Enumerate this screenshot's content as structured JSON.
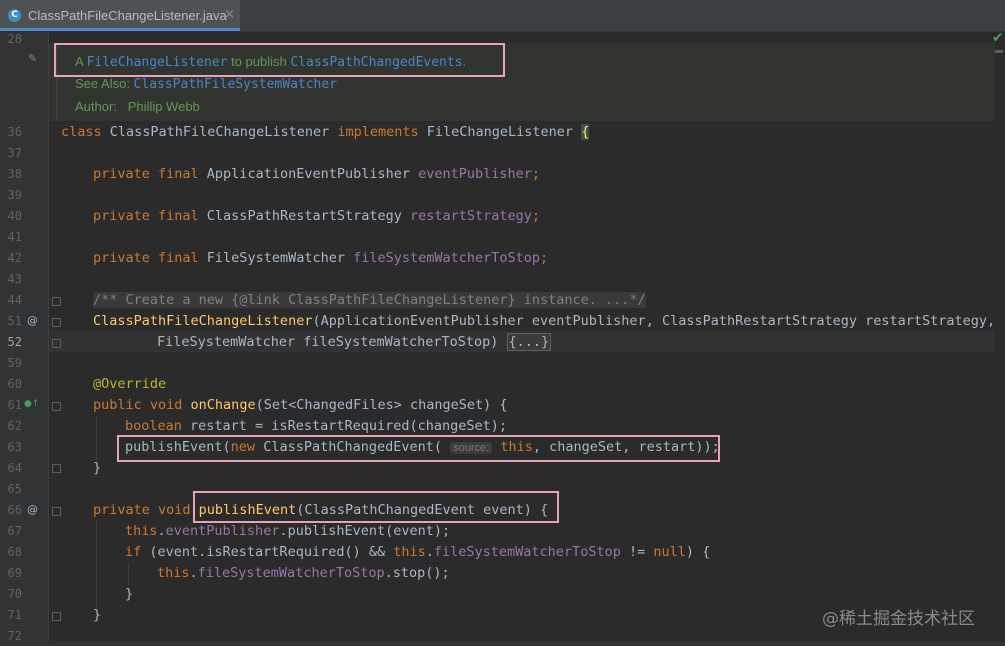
{
  "tab": {
    "title": "ClassPathFileChangeListener.java",
    "close": "×",
    "icon_letter": "C"
  },
  "editor": {
    "line_numbers": [
      "28",
      "36",
      "37",
      "38",
      "39",
      "40",
      "41",
      "42",
      "43",
      "44",
      "51",
      "52",
      "59",
      "60",
      "61",
      "62",
      "63",
      "64",
      "65",
      "66",
      "67",
      "68",
      "69",
      "70",
      "71",
      "72"
    ],
    "current_line": "52",
    "javadoc": {
      "summary_prefix": "A ",
      "summary_link1": "FileChangeListener",
      "summary_middle": " to publish ",
      "summary_link2": "ClassPathChangedEvents",
      "summary_suffix": ".",
      "see_also_label": "See Also: ",
      "see_also_link": "ClassPathFileSystemWatcher",
      "author_label": "Author:",
      "author_name": "Phillip Webb"
    },
    "lines": {
      "l36": {
        "kw1": "class",
        "name": " ClassPathFileChangeListener ",
        "kw2": "implements",
        "iface": " FileChangeListener ",
        "brace": "{"
      },
      "l38": {
        "kw": "private final",
        "type": " ApplicationEventPublisher ",
        "field": "eventPublisher",
        "semi": ";"
      },
      "l40": {
        "kw": "private final",
        "type": " ClassPathRestartStrategy ",
        "field": "restartStrategy",
        "semi": ";"
      },
      "l42": {
        "kw": "private final",
        "type": " FileSystemWatcher ",
        "field": "fileSystemWatcherToStop",
        "semi": ";"
      },
      "l44": {
        "comment": "/** Create a new {@link ClassPathFileChangeListener} instance. ...*/"
      },
      "l51": {
        "method": "ClassPathFileChangeListener",
        "params": "(ApplicationEventPublisher eventPublisher, ClassPathRestartStrategy restartStrategy,"
      },
      "l52": {
        "params": "FileSystemWatcher fileSystemWatcherToStop) ",
        "folded": "{...}"
      },
      "l60": {
        "annotation": "@Override"
      },
      "l61": {
        "kw": "public void ",
        "method": "onChange",
        "params": "(Set<ChangedFiles> changeSet) {"
      },
      "l62": {
        "kw": "boolean",
        "rest": " restart = isRestartRequired(changeSet);"
      },
      "l63": {
        "call": "publishEvent(",
        "kw_new": "new",
        "type": " ClassPathChangedEvent(",
        "hint": "source:",
        "kw_this": " this",
        "rest": ", changeSet, restart));"
      },
      "l64": {
        "text": "}"
      },
      "l66": {
        "kw": "private void ",
        "method": "publishEvent",
        "params": "(ClassPathChangedEvent event) {"
      },
      "l67": {
        "kw_this": "this",
        "dot": ".",
        "field": "eventPublisher",
        "rest": ".publishEvent(event);"
      },
      "l68": {
        "kw_if": "if",
        "part1": " (event.isRestartRequired() && ",
        "kw_this": "this",
        "dot": ".",
        "field": "fileSystemWatcherToStop",
        "part2": " != ",
        "kw_null": "null",
        "part3": ") {"
      },
      "l69": {
        "kw_this": "this",
        "dot": ".",
        "field": "fileSystemWatcherToStop",
        "rest": ".stop();"
      },
      "l70": {
        "text": "}"
      },
      "l71": {
        "text": "}"
      }
    },
    "gutter_icons": {
      "at": "@",
      "override": "●↑"
    }
  },
  "status": {
    "inspection_ok": "✔"
  },
  "watermark": "@稀土掘金技术社区",
  "colors": {
    "keyword": "#cc7832",
    "field": "#9876aa",
    "method": "#ffc66d",
    "annotation": "#bbb529",
    "doc": "#629755",
    "highlight_box": "#e9a3b8"
  }
}
